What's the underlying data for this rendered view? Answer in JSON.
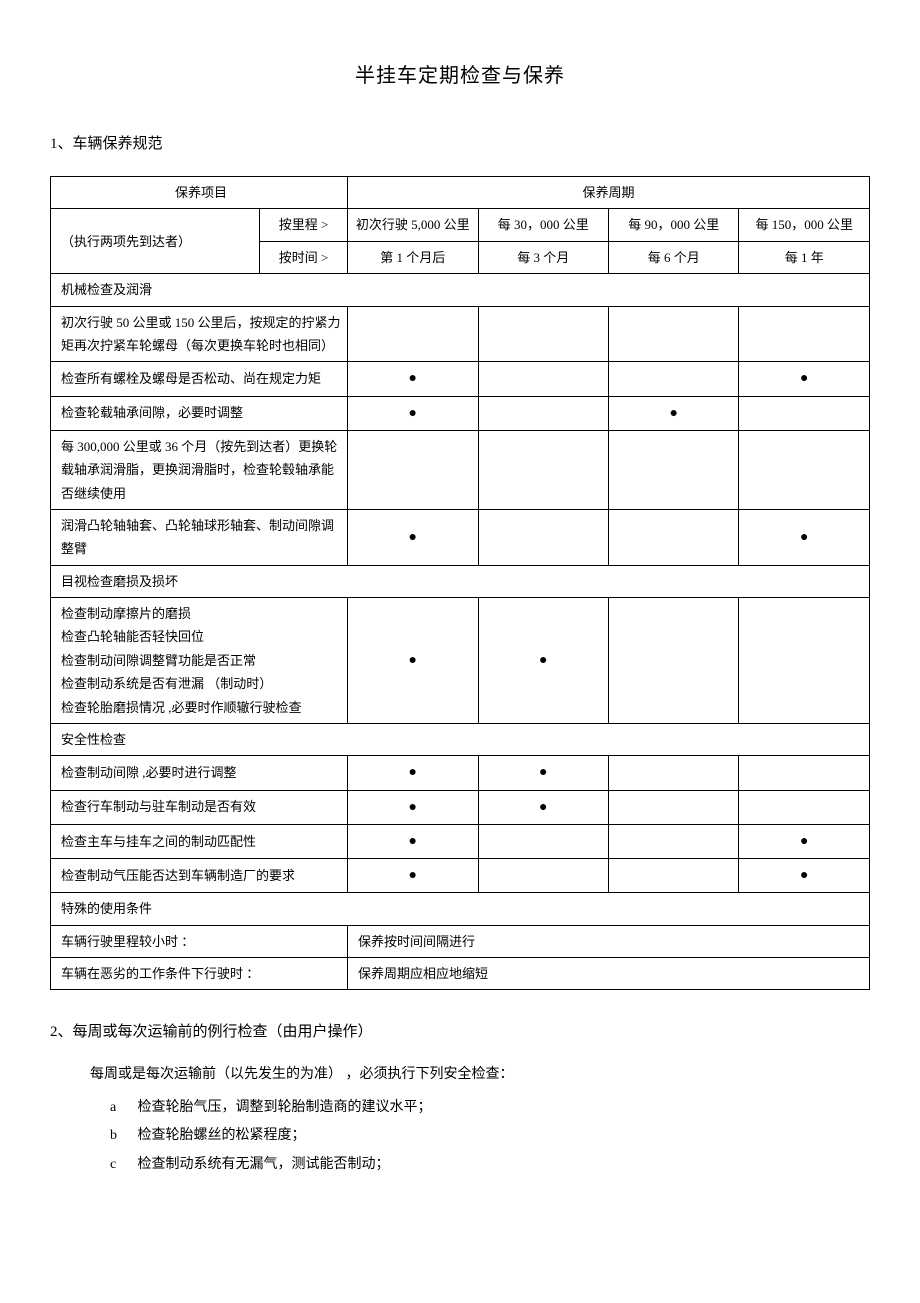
{
  "title": "半挂车定期检查与保养",
  "section1": {
    "heading": "1、车辆保养规范",
    "header": {
      "colItem": "保养项目",
      "colCycle": "保养周期",
      "execNote": "（执行两项先到达者）",
      "byMileage": "按里程 >",
      "byTime": "按时间 >",
      "mileage": [
        "初次行驶 5,000 公里",
        "每 30，000 公里",
        "每 90，000 公里",
        "每 150，000 公里"
      ],
      "time": [
        "第 1 个月后",
        "每 3 个月",
        "每 6 个月",
        "每 1 年"
      ]
    },
    "groups": [
      {
        "title": "机械检查及润滑",
        "rows": [
          {
            "label": "初次行驶  50 公里或  150 公里后，按规定的拧紧力矩再次拧紧车轮螺母（每次更换车轮时也相同）",
            "marks": [
              "",
              "",
              "",
              ""
            ]
          },
          {
            "label": "检查所有螺栓及螺母是否松动、尚在规定力矩",
            "marks": [
              "●",
              "",
              "",
              "●"
            ]
          },
          {
            "label": "检查轮载轴承间隙，必要时调整",
            "marks": [
              "●",
              "",
              "●",
              ""
            ]
          },
          {
            "label": "每 300,000  公里或  36 个月（按先到达者）更换轮载轴承润滑脂，更换润滑脂时，检查轮毂轴承能否继续使用",
            "marks": [
              "",
              "",
              "",
              ""
            ]
          },
          {
            "label": "润滑凸轮轴轴套、凸轮轴球形轴套、制动间隙调整臂",
            "marks": [
              "●",
              "",
              "",
              "●"
            ]
          }
        ]
      },
      {
        "title": "目视检查磨损及损坏",
        "rows": [
          {
            "label": "检查制动摩擦片的磨损\n检查凸轮轴能否轻快回位\n检查制动间隙调整臂功能是否正常\n检查制动系统是否有泄漏  （制动时）\n检查轮胎磨损情况   ,必要时作顺辙行驶检查",
            "marks": [
              "●",
              "●",
              "",
              ""
            ]
          }
        ]
      },
      {
        "title": "安全性检查",
        "rows": [
          {
            "label": "检查制动间隙  ,必要时进行调整",
            "marks": [
              "●",
              "●",
              "",
              ""
            ]
          },
          {
            "label": "检查行车制动与驻车制动是否有效",
            "marks": [
              "●",
              "●",
              "",
              ""
            ]
          },
          {
            "label": "检查主车与挂车之间的制动匹配性",
            "marks": [
              "●",
              "",
              "",
              "●"
            ]
          },
          {
            "label": "检查制动气压能否达到车辆制造厂的要求",
            "marks": [
              "●",
              "",
              "",
              "●"
            ]
          }
        ]
      },
      {
        "title": "特殊的使用条件",
        "rows": [
          {
            "label": "车辆行驶里程较小时  ：",
            "note": "保养按时间间隔进行"
          },
          {
            "label": "车辆在恶劣的工作条件下行驶时   ：",
            "note": "保养周期应相应地缩短"
          }
        ]
      }
    ]
  },
  "section2": {
    "heading": "2、每周或每次运输前的例行检查（由用户操作）",
    "intro": "每周或是每次运输前（以先发生的为准）  ，必须执行下列安全检查：",
    "items": [
      {
        "letter": "a",
        "text": "检查轮胎气压，调整到轮胎制造商的建议水平；"
      },
      {
        "letter": "b",
        "text": "检查轮胎螺丝的松紧程度；"
      },
      {
        "letter": "c",
        "text": "检查制动系统有无漏气，测试能否制动；"
      }
    ]
  }
}
